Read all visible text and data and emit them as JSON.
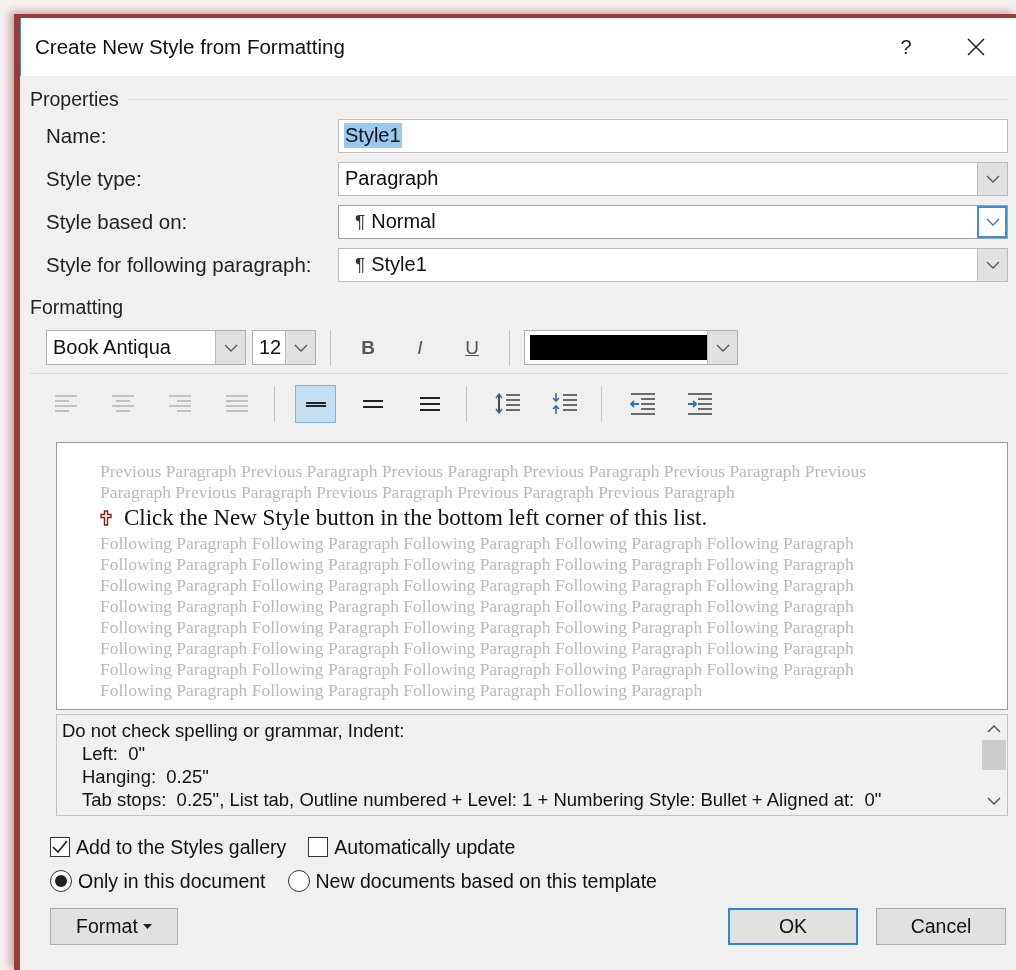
{
  "window": {
    "title": "Create New Style from Formatting",
    "help": "?"
  },
  "properties": {
    "heading": "Properties",
    "rows": [
      {
        "label": "Name:",
        "kind": "text",
        "value": "Style1",
        "selected_text": true
      },
      {
        "label": "Style type:",
        "kind": "select",
        "value": "Paragraph",
        "focused": false
      },
      {
        "label": "Style based on:",
        "kind": "select",
        "marker": "¶",
        "value": "Normal",
        "focused": true
      },
      {
        "label": "Style for following paragraph:",
        "kind": "select",
        "marker": "¶",
        "value": "Style1",
        "focused": false
      }
    ]
  },
  "formatting": {
    "heading": "Formatting",
    "font": "Book Antiqua",
    "size": "12",
    "style_buttons": [
      {
        "label": "B",
        "kind": "bold"
      },
      {
        "label": "I",
        "kind": "italic"
      },
      {
        "label": "U",
        "kind": "underline"
      }
    ],
    "color": "#000000",
    "toolbar": [
      {
        "kind": "align-left",
        "selected": false,
        "disabled": true
      },
      {
        "kind": "align-center",
        "selected": false,
        "disabled": true
      },
      {
        "kind": "align-right",
        "selected": false,
        "disabled": true
      },
      {
        "kind": "justify",
        "selected": false,
        "disabled": true
      },
      {
        "kind": "sep"
      },
      {
        "kind": "single-spacing",
        "selected": true,
        "disabled": false
      },
      {
        "kind": "one-half-spacing",
        "selected": false,
        "disabled": false
      },
      {
        "kind": "double-spacing",
        "selected": false,
        "disabled": false
      },
      {
        "kind": "sep"
      },
      {
        "kind": "space-increase",
        "selected": false,
        "disabled": false
      },
      {
        "kind": "space-decrease",
        "selected": false,
        "disabled": false
      },
      {
        "kind": "sep"
      },
      {
        "kind": "indent-decrease",
        "selected": false,
        "disabled": false
      },
      {
        "kind": "indent-increase",
        "selected": false,
        "disabled": false
      }
    ]
  },
  "preview": {
    "previous_lines": [
      "Previous Paragraph Previous Paragraph Previous Paragraph Previous Paragraph Previous Paragraph Previous",
      "Paragraph Previous Paragraph Previous Paragraph Previous Paragraph Previous Paragraph"
    ],
    "sample": "Click the New Style button in the bottom left corner of this list.",
    "following_lines": [
      "Following Paragraph Following Paragraph Following Paragraph Following Paragraph Following Paragraph",
      "Following Paragraph Following Paragraph Following Paragraph Following Paragraph Following Paragraph",
      "Following Paragraph Following Paragraph Following Paragraph Following Paragraph Following Paragraph",
      "Following Paragraph Following Paragraph Following Paragraph Following Paragraph Following Paragraph",
      "Following Paragraph Following Paragraph Following Paragraph Following Paragraph Following Paragraph",
      "Following Paragraph Following Paragraph Following Paragraph Following Paragraph Following Paragraph",
      "Following Paragraph Following Paragraph Following Paragraph Following Paragraph Following Paragraph",
      "Following Paragraph Following Paragraph Following Paragraph Following Paragraph"
    ]
  },
  "description": {
    "text": "Do not check spelling or grammar, Indent:",
    "children": [
      {
        "text": "Left:  0\""
      },
      {
        "text": "Hanging:  0.25\""
      },
      {
        "text": "Tab stops:  0.25\", List tab, Outline numbered + Level: 1 + Numbering Style: Bullet + Aligned at:  0\""
      }
    ]
  },
  "checkboxes": [
    {
      "label": "Add to the Styles gallery",
      "checked": true
    },
    {
      "label": "Automatically update",
      "checked": false
    }
  ],
  "radios": [
    {
      "label": "Only in this document",
      "selected": true
    },
    {
      "label": "New documents based on this template",
      "selected": false
    }
  ],
  "buttons": {
    "format": "Format",
    "ok": "OK",
    "cancel": "Cancel"
  }
}
